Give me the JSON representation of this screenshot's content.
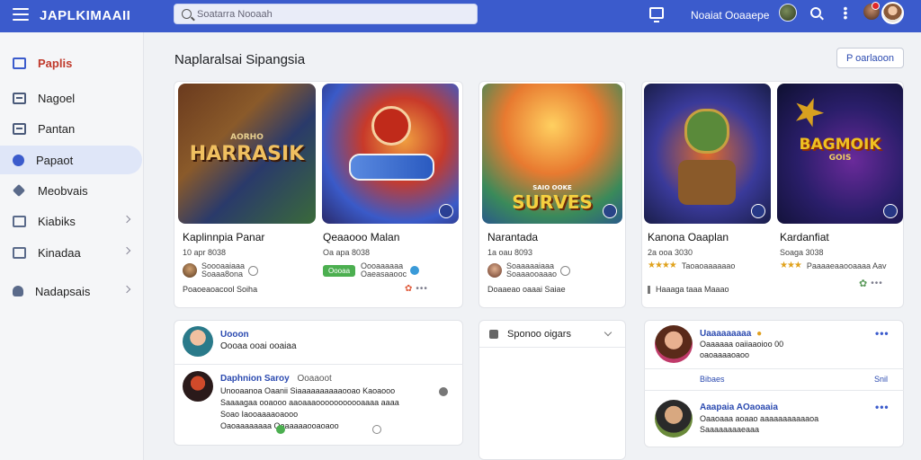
{
  "app": {
    "title": "JAPLKIMAAII"
  },
  "search": {
    "placeholder": "Soatarra Nooaah"
  },
  "topbar": {
    "user_name": "Noaiat Ooaaepe"
  },
  "sidebar": {
    "items": [
      {
        "label": "Paplis",
        "icon": "book-icon"
      },
      {
        "label": "Nagoel",
        "icon": "list-icon"
      },
      {
        "label": "Pantan",
        "icon": "doc-icon"
      },
      {
        "label": "Papaot",
        "icon": "user-icon"
      },
      {
        "label": "Meobvais",
        "icon": "tag-icon"
      },
      {
        "label": "Kiabiks",
        "icon": "grid-icon"
      },
      {
        "label": "Kinadaa",
        "icon": "chart-icon"
      },
      {
        "label": "Nadapsais",
        "icon": "person-icon"
      }
    ]
  },
  "main": {
    "section_title": "Naplaralsai Sipangsia",
    "header_button": "P oarlaoon"
  },
  "games": [
    {
      "art_title": "HARRASIK",
      "art_subtitle": "AORHO",
      "name": "Kaplinnpia Panar",
      "meta": "10 apr 8038",
      "row": "Soooaaiaaa\nSoaaa8ona",
      "foot": "Poaoeaoacool Soiha",
      "art_colors": [
        "#5a3a1e",
        "#2a4a7a"
      ],
      "title_color": "#f0c060"
    },
    {
      "art_title": "",
      "art_subtitle": "",
      "name": "Qeaaooo Malan",
      "meta": "Oa apa 8038",
      "tag": "Oooaa",
      "row": "Oooaaaaaa\nOaeasaaooc",
      "foot": "",
      "art_colors": [
        "#b83a2a",
        "#3a6ac8"
      ],
      "title_color": "#ffffff"
    },
    {
      "art_title": "SURVES",
      "art_subtitle": "SAIO OOKE",
      "name": "Narantada",
      "meta": "1a oau 8093",
      "row": "Soaaaaaiaaa\nSoaaaooaaao",
      "foot": "Doaaeao oaaai Saiae",
      "art_colors": [
        "#e8a030",
        "#3a9a5a"
      ],
      "title_color": "#f5d040"
    },
    {
      "art_title": "",
      "art_subtitle": "",
      "name": "Kanona Oaaplan",
      "meta": "2a ooa 3030",
      "row": "Taoaoaaaaaao",
      "foot": "Haaaga taaa Maaao",
      "art_colors": [
        "#2a3a8a",
        "#d05a2a"
      ],
      "title_color": "#ffffff"
    },
    {
      "art_title": "BAGMOIK",
      "art_subtitle": "GOIS",
      "name": "Kardanfiat",
      "meta": "Soaga 3038",
      "row": "Paaaaeaaooaaaa Aav",
      "foot": "",
      "art_colors": [
        "#1a1e5a",
        "#6a2a9a"
      ],
      "title_color": "#f0c020"
    }
  ],
  "feed_left": [
    {
      "name": "Uooon",
      "text": "Oooaa ooai ooaiaa",
      "avatar": "teal"
    },
    {
      "name": "Daphnion Saroy",
      "suffix": "Ooaaoot",
      "text": "Unooaanoa Oaanii Siaaaaaaaaaaooao Kaoaooo\nSaaaagaa ooaooo aaoaaaooooooooooaaaa aaaa\nSoao  Iaooaaaaoaooo\nOaoaaaaaaaa   Ooaaaaaooaoaoo",
      "avatar": "dark"
    }
  ],
  "dropdown": {
    "label": "Sponoo oigars"
  },
  "feed_right": [
    {
      "name": "Uaaaaaaaaa",
      "text": "Oaaaaaa oaiiaaoioo 00\noaoaaaaoaoo",
      "link_left": "Bibaes",
      "link_right": "Snil",
      "avatar": "woman"
    },
    {
      "name": "Aaapaia AOaoaaia",
      "text": "Oaaoaaa aoaao aaaaaaaaaaaoa\nSaaaaaaaaeaaa",
      "avatar": "man"
    }
  ],
  "colors": {
    "topbar": "#3b5bcc",
    "accent": "#2b4ab0",
    "active_bg": "#dfe6f8"
  }
}
